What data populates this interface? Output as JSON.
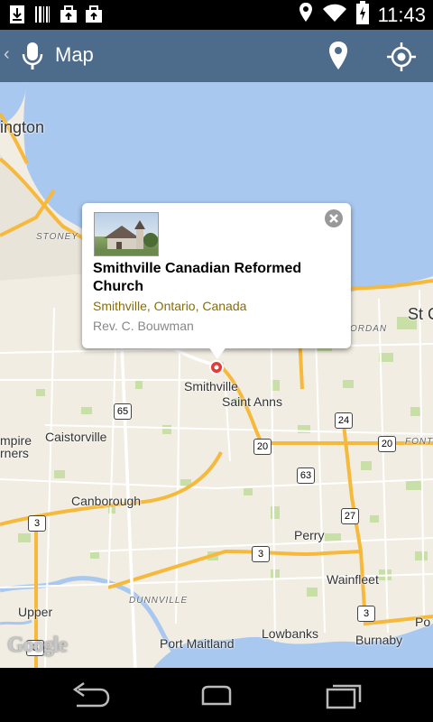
{
  "status_bar": {
    "time": "11:43",
    "left_icons": [
      "download-icon",
      "barcode-icon",
      "briefcase-upload-icon",
      "briefcase-upload-icon"
    ],
    "right_icons": [
      "location-icon",
      "wifi-icon",
      "battery-charging-icon"
    ]
  },
  "action_bar": {
    "title": "Map",
    "icons": [
      "back-chevron-icon",
      "microphone-icon",
      "place-marker-icon",
      "my-location-icon"
    ]
  },
  "popup": {
    "name": "Smithville Canadian Reformed Church",
    "location": "Smithville, Ontario, Canada",
    "pastor": "Rev. C. Bouwman"
  },
  "map": {
    "labels": {
      "burlington": "ington",
      "st_catharines": "St C",
      "smithville": "Smithville",
      "saint_anns": "Saint Anns",
      "caistorville": "Caistorville",
      "empire_corners_1": "mpire",
      "empire_corners_2": "rners",
      "canborough": "Canborough",
      "perry": "Perry",
      "wainfleet": "Wainfleet",
      "upper": "Upper",
      "lowbanks": "Lowbanks",
      "port_maitland": "Port Maitland",
      "burnaby": "Burnaby",
      "port_right": "Po",
      "stoney_creek": "STONEY C",
      "jordan": "ORDAN",
      "dunnville": "DUNNVILLE",
      "fonthill": "FONT"
    },
    "shields": {
      "s65": "65",
      "s24": "24",
      "s20a": "20",
      "s20b": "20",
      "s63": "63",
      "s27": "27",
      "s3a": "3",
      "s3b": "3",
      "s3c": "3",
      "s3d": "3"
    },
    "logo": "Google",
    "colors": {
      "water": "#a9c8ef",
      "land": "#f1ede2",
      "highway": "#f6b93b",
      "road": "#ffffff",
      "green": "#c9dfa8"
    }
  },
  "nav_bar": {
    "icons": [
      "back-arrow-icon",
      "home-icon",
      "recent-apps-icon"
    ]
  }
}
